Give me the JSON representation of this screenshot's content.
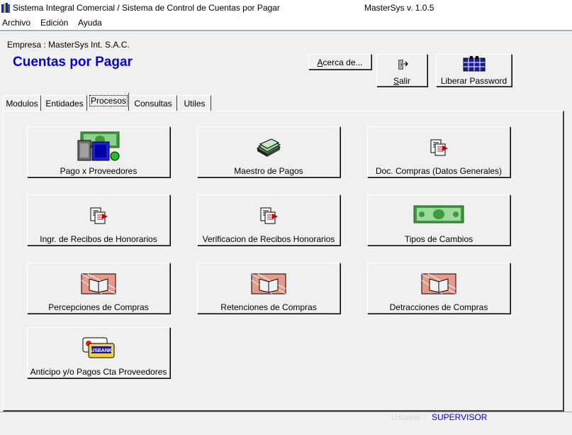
{
  "window": {
    "title": "Sistema Integral Comercial / Sistema de Control de Cuentas por Pagar",
    "version": "MasterSys v. 1.0.5"
  },
  "menu": [
    "Archivo",
    "Edición",
    "Ayuda"
  ],
  "company": "Empresa : MasterSys Int. S.A.C.",
  "page_title": "Cuentas por Pagar",
  "toolbar": {
    "about": "Acerca de...",
    "exit": "Salir",
    "password": "Liberar Password"
  },
  "tabs": [
    "Modulos",
    "Entidades",
    "Procesos",
    "Consultas",
    "Utiles"
  ],
  "active_tab": "Procesos",
  "process_buttons": [
    {
      "label": "Pago x Proveedores",
      "icon": "cash-phone-icon"
    },
    {
      "label": "Maestro de Pagos",
      "icon": "money-stack-icon"
    },
    {
      "label": "Doc. Compras (Datos Generales)",
      "icon": "documents-icon"
    },
    {
      "label": "Ingr. de Recibos de Honorarios",
      "icon": "documents-icon"
    },
    {
      "label": "Verificacion de Recibos Honorarios",
      "icon": "documents-icon"
    },
    {
      "label": "Tipos de Cambios",
      "icon": "banknote-icon"
    },
    {
      "label": "Percepciones de Compras",
      "icon": "ledger-book-icon"
    },
    {
      "label": "Retenciones de Compras",
      "icon": "ledger-book-icon"
    },
    {
      "label": "Detracciones de Compras",
      "icon": "ledger-book-icon"
    },
    {
      "label": "Anticipo y/o Pagos Cta Proveedores",
      "icon": "bank-cards-icon"
    }
  ],
  "status": {
    "user_label": "Usuario :",
    "user_value": "SUPERVISOR"
  },
  "colors": {
    "title_blue": "#0000e0",
    "money_green": "#2e8b2e"
  }
}
